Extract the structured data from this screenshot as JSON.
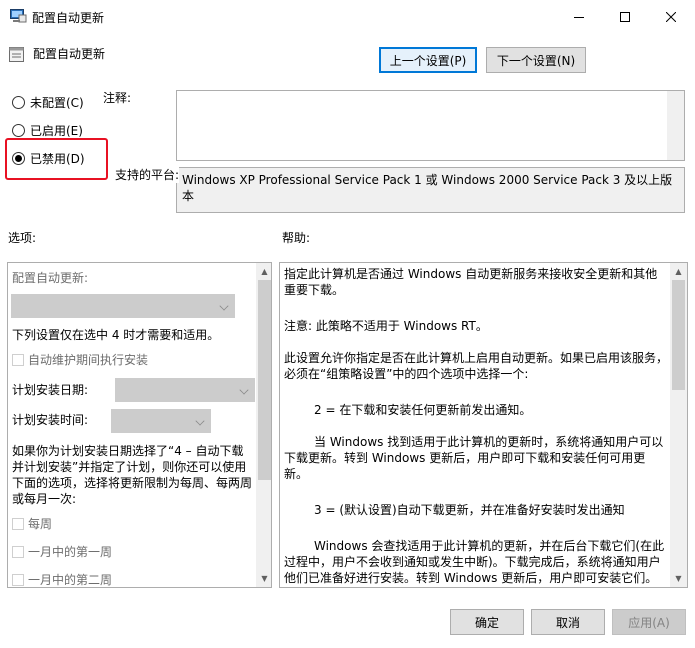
{
  "window": {
    "title": "配置自动更新"
  },
  "header": {
    "policy_title": "配置自动更新",
    "prev_button": "上一个设置(P)",
    "next_button": "下一个设置(N)"
  },
  "state": {
    "not_configured": "未配置(C)",
    "enabled": "已启用(E)",
    "disabled": "已禁用(D)",
    "selected": "disabled"
  },
  "comment": {
    "label": "注释:",
    "value": ""
  },
  "platform": {
    "label": "支持的平台:",
    "value": "Windows XP Professional Service Pack 1 或 Windows 2000 Service Pack 3 及以上版本"
  },
  "options": {
    "label": "选项:",
    "configure_label": "配置自动更新:",
    "note": "下列设置仅在选中 4 时才需要和适用。",
    "maintenance_checkbox": "自动维护期间执行安装",
    "schedule_day_label": "计划安装日期:",
    "schedule_time_label": "计划安装时间:",
    "paragraph_line1": "如果你为计划安装日期选择了“4 – 自动下载",
    "paragraph_line2": "并计划安装”并指定了计划，则你还可以使用",
    "paragraph_line3": "下面的选项，选择将更新限制为每周、每两周",
    "paragraph_line4": "或每月一次:",
    "weekly": "每周",
    "first_week": "一月中的第一周",
    "second_week": "一月中的第二周"
  },
  "help": {
    "label": "帮助:",
    "p1": "指定此计算机是否通过 Windows 自动更新服务来接收安全更新和其他重要下载。",
    "p2": "注意: 此策略不适用于 Windows RT。",
    "p3": "此设置允许你指定是否在此计算机上启用自动更新。如果已启用该服务，必须在“组策略设置”中的四个选项中选择一个:",
    "p4": "2 = 在下载和安装任何更新前发出通知。",
    "p5": "当 Windows 找到适用于此计算机的更新时，系统将通知用户可以下载更新。转到 Windows 更新后，用户即可下载和安装任何可用更新。",
    "p6": "3 = (默认设置)自动下载更新，并在准备好安装时发出通知",
    "p7": "Windows 会查找适用于此计算机的更新，并在后台下载它们(在此过程中，用户不会收到通知或发生中断)。下载完成后，系统将通知用户他们已准备好进行安装。转到 Windows 更新后，用户即可安装它们。"
  },
  "footer": {
    "ok": "确定",
    "cancel": "取消",
    "apply": "应用(A)"
  },
  "colors": {
    "highlight": "#e81123",
    "focus_border": "#0078d7"
  }
}
